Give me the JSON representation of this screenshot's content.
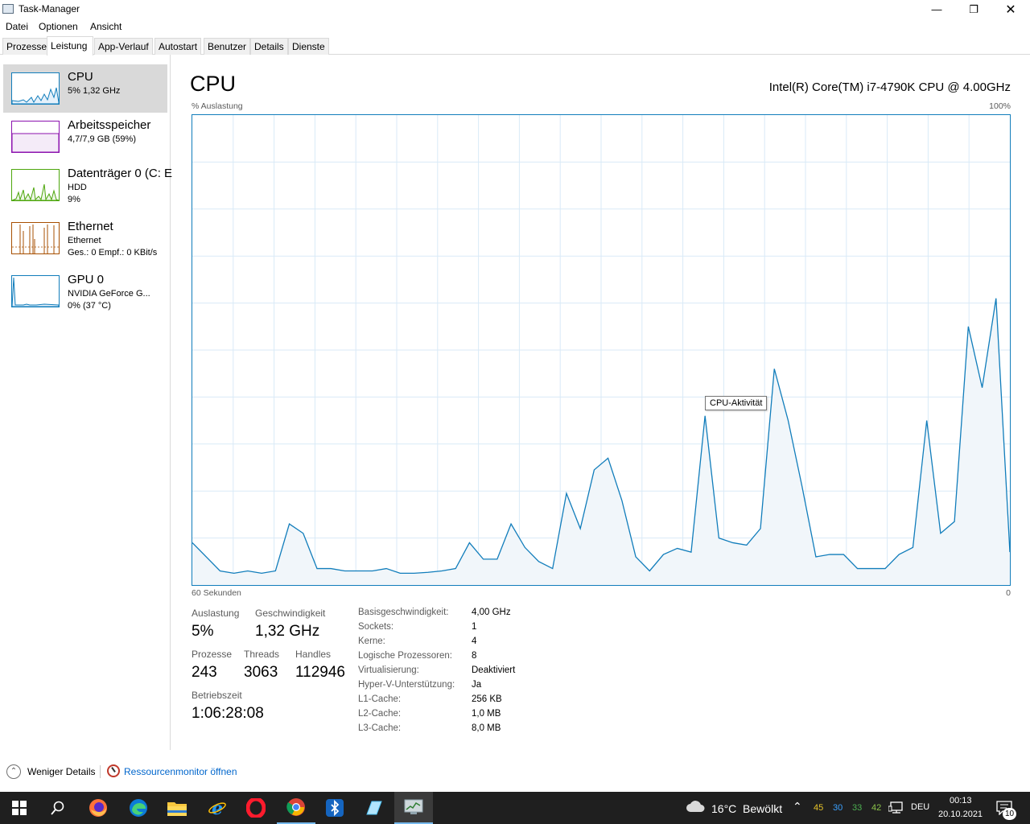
{
  "window": {
    "title": "Task-Manager"
  },
  "menu": [
    "Datei",
    "Optionen",
    "Ansicht"
  ],
  "tabs": [
    "Prozesse",
    "Leistung",
    "App-Verlauf",
    "Autostart",
    "Benutzer",
    "Details",
    "Dienste"
  ],
  "sidebar": {
    "items": [
      {
        "name": "CPU",
        "sub1": "5%  1,32 GHz",
        "sub2": "",
        "color": "#117dbb"
      },
      {
        "name": "Arbeitsspeicher",
        "sub1": "4,7/7,9 GB (59%)",
        "sub2": "",
        "color": "#8b12ae"
      },
      {
        "name": "Datenträger 0 (C: E",
        "sub1": "HDD",
        "sub2": "9%",
        "color": "#4da60c"
      },
      {
        "name": "Ethernet",
        "sub1": "Ethernet",
        "sub2": "Ges.: 0 Empf.: 0 KBit/s",
        "color": "#a74f01"
      },
      {
        "name": "GPU 0",
        "sub1": "NVIDIA GeForce G...",
        "sub2": "0% (37 °C)",
        "color": "#117dbb"
      }
    ]
  },
  "main": {
    "heading": "CPU",
    "cpu_model": "Intel(R) Core(TM) i7-4790K CPU @ 4.00GHz",
    "y_label": "% Auslastung",
    "y_max": "100%",
    "x_left": "60 Sekunden",
    "x_right": "0",
    "tooltip": "CPU-Aktivität"
  },
  "chart_data": {
    "type": "area",
    "ylim": [
      0,
      100
    ],
    "values": [
      9,
      6,
      3,
      2.5,
      3,
      2.5,
      3,
      13,
      11,
      3.5,
      3.5,
      3,
      3,
      3,
      3.5,
      2.5,
      2.5,
      2.7,
      3,
      3.5,
      9,
      5.5,
      5.5,
      13,
      8,
      5,
      3.5,
      19.5,
      12,
      24.5,
      27,
      18,
      6,
      3,
      6.5,
      7.8,
      7,
      36,
      10,
      9,
      8.5,
      12,
      46,
      35,
      21,
      6,
      6.5,
      6.5,
      3.5,
      3.5,
      3.5,
      6.5,
      8,
      35,
      11,
      13.5,
      55,
      42,
      61,
      7
    ]
  },
  "stats": {
    "auslastung_label": "Auslastung",
    "auslastung": "5%",
    "geschwindigkeit_label": "Geschwindigkeit",
    "geschwindigkeit": "1,32 GHz",
    "prozesse_label": "Prozesse",
    "prozesse": "243",
    "threads_label": "Threads",
    "threads": "3063",
    "handles_label": "Handles",
    "handles": "112946",
    "betriebszeit_label": "Betriebszeit",
    "betriebszeit": "1:06:28:08"
  },
  "info": [
    {
      "key": "Basisgeschwindigkeit:",
      "val": "4,00 GHz"
    },
    {
      "key": "Sockets:",
      "val": "1"
    },
    {
      "key": "Kerne:",
      "val": "4"
    },
    {
      "key": "Logische Prozessoren:",
      "val": "8"
    },
    {
      "key": "Virtualisierung:",
      "val": "Deaktiviert"
    },
    {
      "key": "Hyper-V-Unterstützung:",
      "val": "Ja"
    },
    {
      "key": "L1-Cache:",
      "val": "256 KB"
    },
    {
      "key": "L2-Cache:",
      "val": "1,0 MB"
    },
    {
      "key": "L3-Cache:",
      "val": "8,0 MB"
    }
  ],
  "footer": {
    "fewer_details": "Weniger Details",
    "resource_monitor": "Ressourcenmonitor öffnen"
  },
  "taskbar": {
    "weather": "16°C  Bewölkt",
    "tray_numbers": [
      "45",
      "30",
      "33",
      "42"
    ],
    "tray_colors": [
      "#e6c229",
      "#3aa0ff",
      "#4caf50",
      "#8bc34a"
    ],
    "language": "DEU",
    "time": "00:13",
    "date": "20.10.2021",
    "notifications": "10"
  }
}
